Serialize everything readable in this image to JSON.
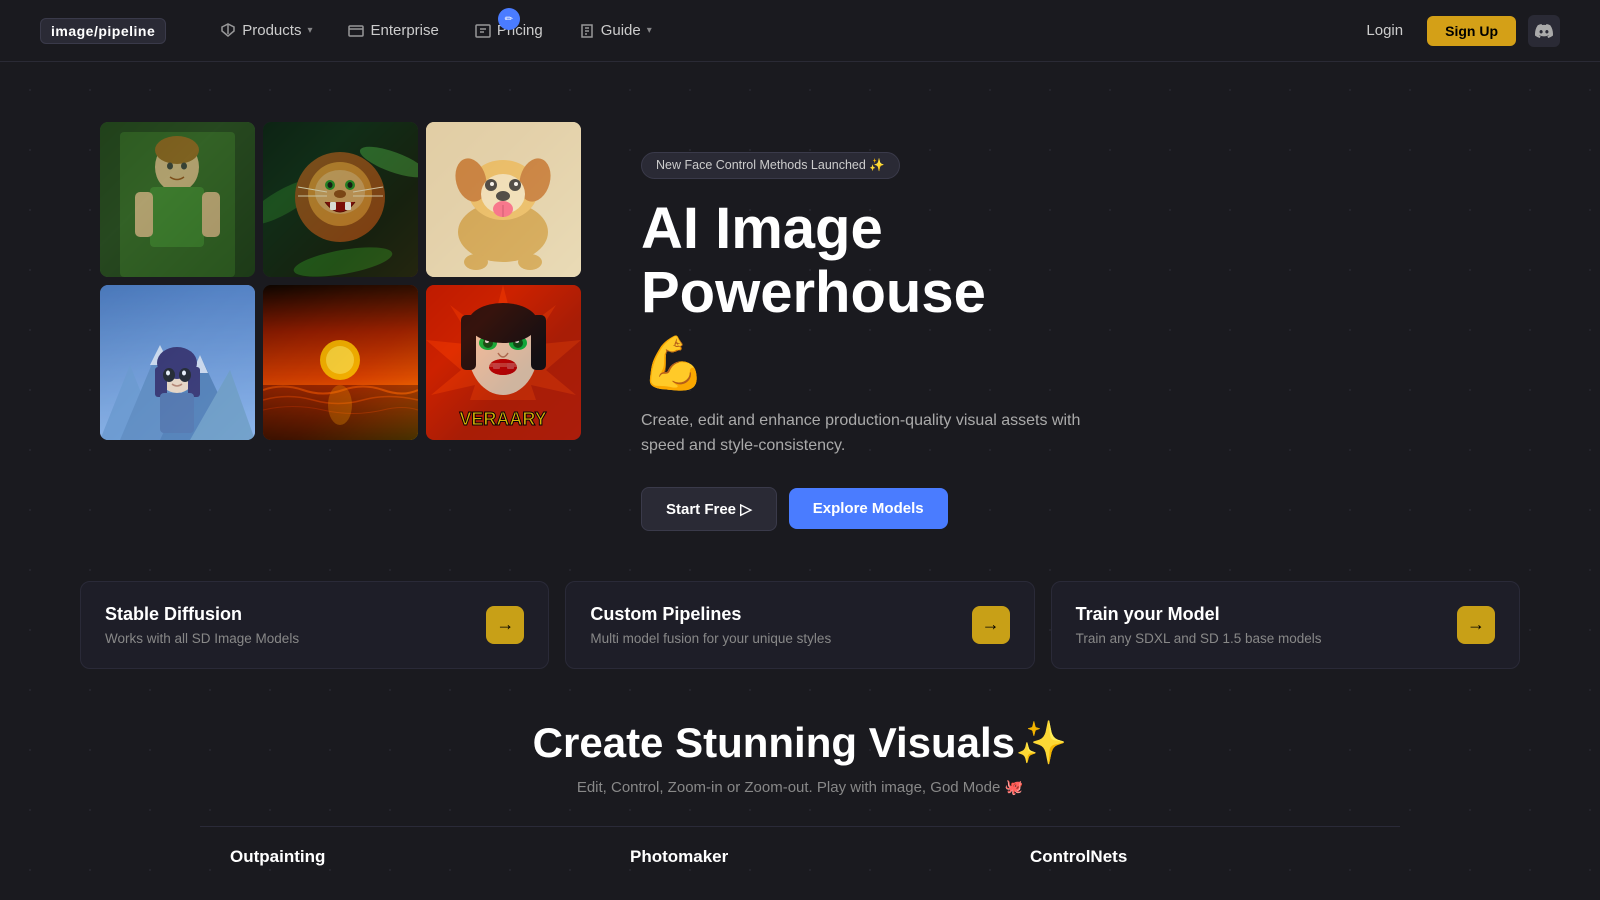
{
  "nav": {
    "logo": "image/pipeline",
    "links": [
      {
        "id": "products",
        "label": "Products",
        "hasDropdown": true,
        "icon": "pencil"
      },
      {
        "id": "enterprise",
        "label": "Enterprise",
        "hasDropdown": false,
        "icon": "layers"
      },
      {
        "id": "pricing",
        "label": "Pricing",
        "hasDropdown": false,
        "icon": "dollar",
        "active": true
      },
      {
        "id": "guide",
        "label": "Guide",
        "hasDropdown": true,
        "icon": "book"
      }
    ],
    "login_label": "Login",
    "signup_label": "Sign Up",
    "discord_icon": "💬"
  },
  "hero": {
    "badge_text": "New Face Control Methods Launched ✨",
    "title": "AI Image Powerhouse",
    "emoji": "💪",
    "subtitle": "Create, edit and enhance production-quality visual assets with speed and style-consistency.",
    "btn_start": "Start Free ▷",
    "btn_explore": "Explore Models"
  },
  "feature_cards": [
    {
      "id": "stable-diffusion",
      "title": "Stable Diffusion",
      "desc": "Works with all SD Image Models",
      "arrow": "→"
    },
    {
      "id": "custom-pipelines",
      "title": "Custom Pipelines",
      "desc": "Multi model fusion for your unique styles",
      "arrow": "→"
    },
    {
      "id": "train-model",
      "title": "Train your Model",
      "desc": "Train any SDXL and SD 1.5 base models",
      "arrow": "→"
    }
  ],
  "bottom": {
    "title": "Create Stunning Visuals✨",
    "subtitle": "Edit, Control, Zoom-in or Zoom-out. Play with image, God Mode 🐙"
  },
  "bottom_features": [
    {
      "id": "outpainting",
      "title": "Outpainting"
    },
    {
      "id": "photomaker",
      "title": "Photomaker"
    },
    {
      "id": "controlnets",
      "title": "ControlNets"
    }
  ],
  "images": [
    {
      "id": "boy",
      "emoji": "👦",
      "label": "boy in green shirt"
    },
    {
      "id": "lion",
      "emoji": "🦁",
      "label": "roaring lion"
    },
    {
      "id": "dog",
      "emoji": "🐕",
      "label": "corgi dog"
    },
    {
      "id": "anime",
      "emoji": "👧",
      "label": "anime girl"
    },
    {
      "id": "sunset",
      "emoji": "🌅",
      "label": "sunset waves"
    },
    {
      "id": "comic",
      "emoji": "🎭",
      "label": "comic woman"
    }
  ]
}
